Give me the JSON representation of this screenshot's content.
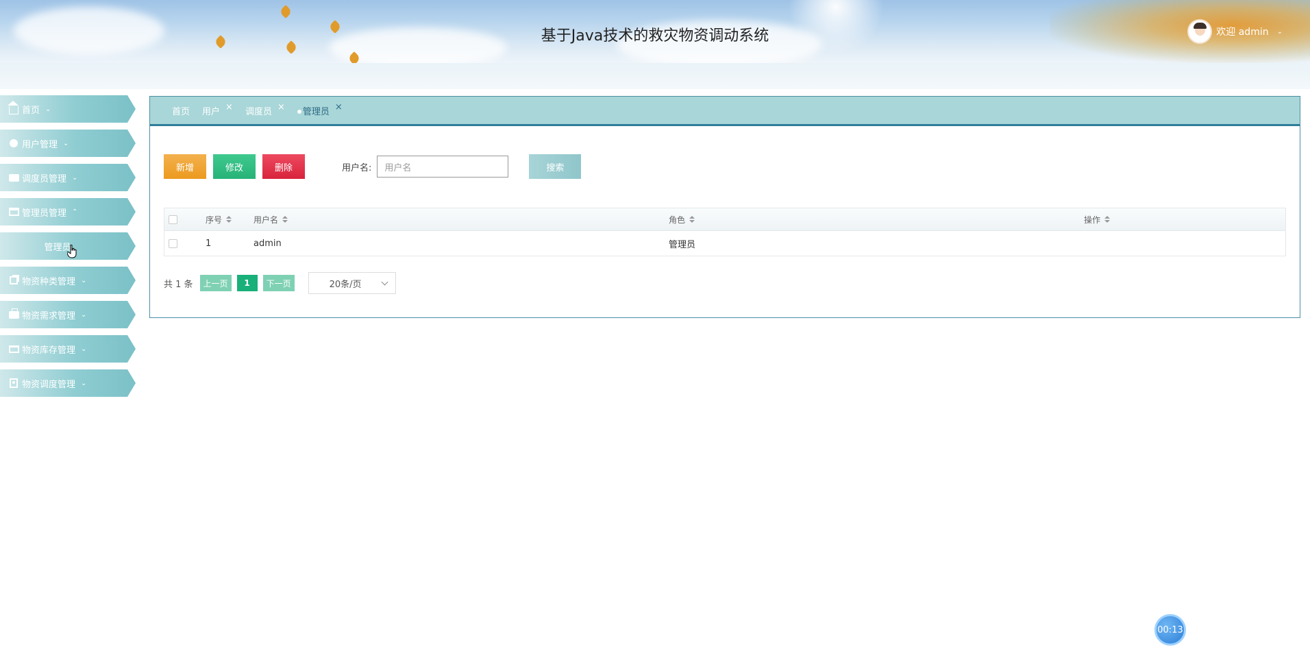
{
  "header": {
    "title": "基于Java技术的救灾物资调动系统",
    "welcome": "欢迎 admin"
  },
  "sidebar": {
    "items": [
      {
        "label": "首页",
        "icon": "home-icon"
      },
      {
        "label": "用户管理",
        "icon": "user-icon"
      },
      {
        "label": "调度员管理",
        "icon": "briefcase-icon"
      },
      {
        "label": "管理员管理",
        "icon": "card-icon"
      },
      {
        "label": "管理员",
        "icon": ""
      },
      {
        "label": "物资种类管理",
        "icon": "copy-icon"
      },
      {
        "label": "物资需求管理",
        "icon": "bag-icon"
      },
      {
        "label": "物资库存管理",
        "icon": "folder-icon"
      },
      {
        "label": "物资调度管理",
        "icon": "document-icon"
      }
    ]
  },
  "tabs": [
    {
      "label": "首页"
    },
    {
      "label": "用户"
    },
    {
      "label": "调度员"
    },
    {
      "label": "管理员"
    }
  ],
  "toolbar": {
    "add": "新增",
    "edit": "修改",
    "delete": "删除",
    "username_label": "用户名:",
    "username_placeholder": "用户名",
    "search": "搜索"
  },
  "table": {
    "columns": [
      "序号",
      "用户名",
      "角色",
      "操作"
    ],
    "rows": [
      {
        "index": "1",
        "username": "admin",
        "role": "管理员"
      }
    ]
  },
  "pager": {
    "total": "共 1 条",
    "prev": "上一页",
    "page": "1",
    "next": "下一页",
    "size": "20条/页"
  },
  "timer": "00:13",
  "colors": {
    "accent": "#2e7d9a",
    "sidebar": "#8fcdd2",
    "add": "#ec9a1f",
    "edit": "#27b378",
    "delete": "#d8233c",
    "page_active": "#19b07a"
  }
}
